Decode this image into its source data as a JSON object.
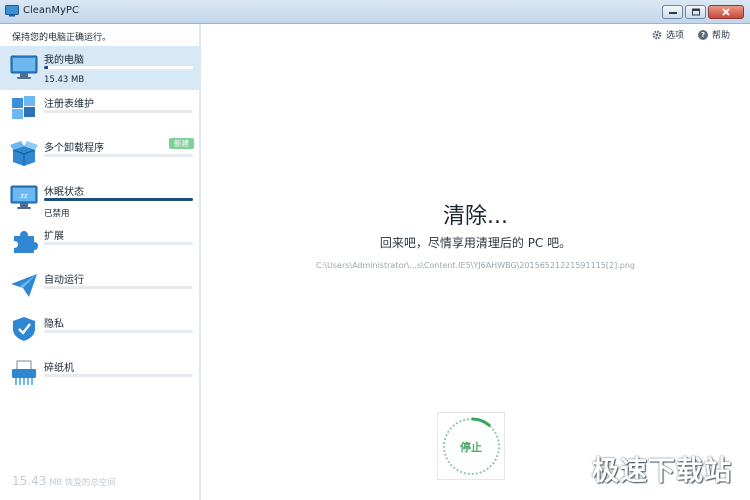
{
  "window": {
    "title": "CleanMyPC"
  },
  "sidebar": {
    "tagline": "保持您的电脑正确运行。",
    "items": [
      {
        "label": "我的电脑",
        "sub": "15.43 MB",
        "icon": "monitor-icon",
        "progress": 0.03
      },
      {
        "label": "注册表维护",
        "icon": "registry-blocks-icon",
        "progress": 0
      },
      {
        "label": "多个卸载程序",
        "badge": "新建",
        "icon": "open-box-icon",
        "progress": 0
      },
      {
        "label": "休眠状态",
        "sub": "已禁用",
        "icon": "sleep-monitor-icon",
        "progress": 1.0
      },
      {
        "label": "扩展",
        "icon": "puzzle-icon",
        "progress": 0
      },
      {
        "label": "自动运行",
        "icon": "paper-plane-icon",
        "progress": 0
      },
      {
        "label": "隐私",
        "icon": "shield-icon",
        "progress": 0
      },
      {
        "label": "碎纸机",
        "icon": "shredder-icon",
        "progress": 0
      }
    ],
    "footer": {
      "amount": "15.43",
      "text": "MB 恢复的总空间"
    }
  },
  "toplinks": {
    "options": "选项",
    "help": "帮助"
  },
  "main": {
    "heading": "清除...",
    "subheading": "回来吧，尽情享用清理后的 PC 吧。",
    "filepath": "C:\\Users\\Administrator\\...s\\Content.IE5\\YJ6AHWBG\\20156521221591115[2].png",
    "stop_button": "停止"
  },
  "watermark": "极速下载站",
  "colors": {
    "accent": "#1d4d7a",
    "selected_bg": "#d7e8f7",
    "stop_green": "#4aa868",
    "badge_green": "#7fcf9a"
  }
}
